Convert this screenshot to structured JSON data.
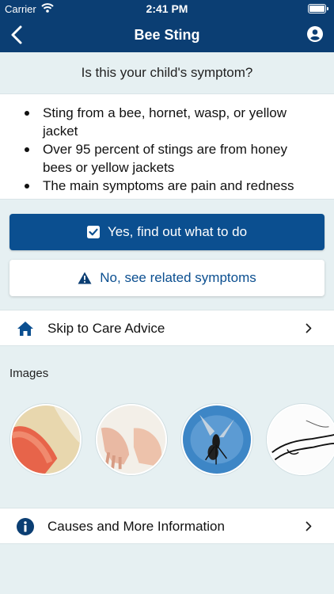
{
  "status_bar": {
    "carrier": "Carrier",
    "time": "2:41 PM"
  },
  "nav": {
    "title": "Bee Sting",
    "back_icon": "chevron-left-icon",
    "account_icon": "account-circle-icon"
  },
  "question": "Is this your child's symptom?",
  "symptoms": [
    "Sting from a bee, hornet, wasp, or yellow jacket",
    "Over 95 percent of stings are from honey bees or yellow jackets",
    "The main symptoms are pain and redness"
  ],
  "yes_button": {
    "label": "Yes, find out what to do",
    "icon": "checkbox-checked-icon"
  },
  "no_button": {
    "label": "No, see related symptoms",
    "icon": "warning-icon"
  },
  "care_advice": {
    "label": "Skip to Care Advice",
    "icon": "home-icon"
  },
  "images_label": "Images",
  "causes": {
    "label": "Causes and More Information",
    "icon": "info-icon"
  },
  "colors": {
    "nav_bg": "#0b3e73",
    "primary": "#0b4f90",
    "page_bg": "#e6f0f2"
  }
}
